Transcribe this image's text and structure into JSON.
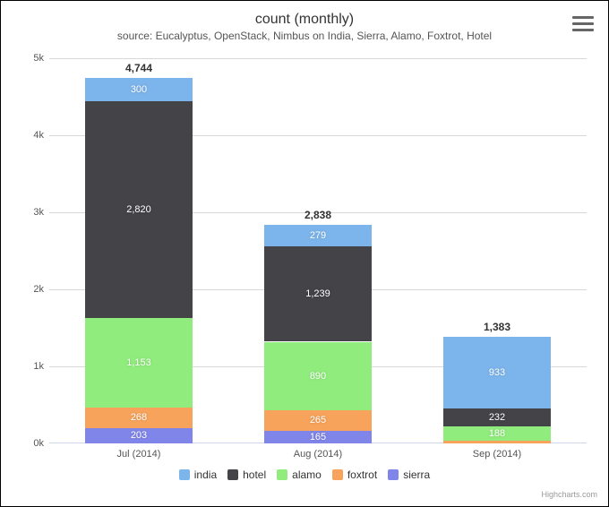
{
  "chart_data": {
    "type": "bar",
    "stacked": true,
    "title": "count (monthly)",
    "subtitle": "source: Eucalyptus, OpenStack, Nimbus on India, Sierra, Alamo, Foxtrot, Hotel",
    "categories": [
      "Jul (2014)",
      "Aug (2014)",
      "Sep (2014)"
    ],
    "series": [
      {
        "name": "sierra",
        "color": "#8085e9",
        "values": [
          203,
          165,
          0
        ]
      },
      {
        "name": "foxtrot",
        "color": "#f7a35c",
        "values": [
          268,
          265,
          30
        ]
      },
      {
        "name": "alamo",
        "color": "#90ed7d",
        "values": [
          1153,
          890,
          188
        ]
      },
      {
        "name": "hotel",
        "color": "#434348",
        "values": [
          2820,
          1239,
          232
        ]
      },
      {
        "name": "india",
        "color": "#7cb5ec",
        "values": [
          300,
          279,
          933
        ]
      }
    ],
    "totals": [
      4744,
      2838,
      1383
    ],
    "ylim": [
      0,
      5000
    ],
    "yticks": [
      {
        "v": 0,
        "label": "0k"
      },
      {
        "v": 1000,
        "label": "1k"
      },
      {
        "v": 2000,
        "label": "2k"
      },
      {
        "v": 3000,
        "label": "3k"
      },
      {
        "v": 4000,
        "label": "4k"
      },
      {
        "v": 5000,
        "label": "5k"
      }
    ],
    "legend_order": [
      "india",
      "hotel",
      "alamo",
      "foxtrot",
      "sierra"
    ],
    "credits": "Highcharts.com"
  }
}
